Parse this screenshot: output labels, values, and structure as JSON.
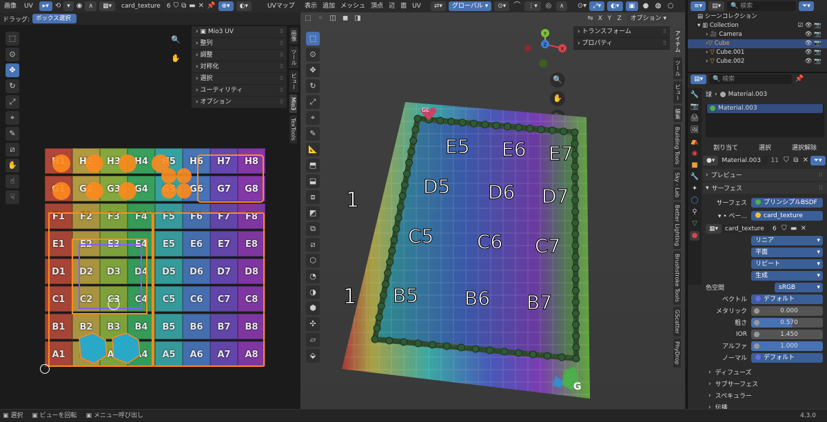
{
  "uv_editor": {
    "header": {
      "menu": [
        "画像",
        "UV"
      ],
      "image_name": "card_texture",
      "user_count": "6",
      "uv_map_label": "UVマップ",
      "drag_label": "ドラッグ:",
      "drag_mode": "ボックス選択"
    },
    "npanel": [
      "Mio3 UV",
      "整列",
      "調整",
      "対称化",
      "選択",
      "ユーティリティ",
      "オプション"
    ],
    "side_tabs": [
      "画像",
      "ツール",
      "ビュー",
      "Mio3",
      "TexTools"
    ],
    "grid_rows": [
      {
        "r": "H",
        "cells": [
          "H1",
          "H2",
          "H3",
          "H4",
          "H5",
          "H6",
          "H7",
          "H8"
        ]
      },
      {
        "r": "G",
        "cells": [
          "G1",
          "G2",
          "G3",
          "G4",
          "G5",
          "G6",
          "G7",
          "G8"
        ]
      },
      {
        "r": "F",
        "cells": [
          "F1",
          "F2",
          "F3",
          "F4",
          "F5",
          "F6",
          "F7",
          "F8"
        ]
      },
      {
        "r": "E",
        "cells": [
          "E1",
          "E2",
          "E3",
          "E4",
          "E5",
          "E6",
          "E7",
          "E8"
        ]
      },
      {
        "r": "D",
        "cells": [
          "D1",
          "D2",
          "D3",
          "D4",
          "D5",
          "D6",
          "D7",
          "D8"
        ]
      },
      {
        "r": "C",
        "cells": [
          "C1",
          "C2",
          "C3",
          "C4",
          "C5",
          "C6",
          "C7",
          "C8"
        ]
      },
      {
        "r": "B",
        "cells": [
          "B1",
          "B2",
          "B3",
          "B4",
          "B5",
          "B6",
          "B7",
          "B8"
        ]
      },
      {
        "r": "A",
        "cells": [
          "A1",
          "A2",
          "A3",
          "A4",
          "A5",
          "A6",
          "A7",
          "A8"
        ]
      }
    ]
  },
  "viewport": {
    "header": {
      "menu": [
        "表示",
        "追加",
        "メッシュ",
        "頂点",
        "辺",
        "面",
        "UV"
      ],
      "transform_orientation": "グローバル",
      "options_label": "オプション",
      "axes": [
        "X",
        "Y",
        "Z"
      ]
    },
    "npanel": [
      "トランスフォーム",
      "プロパティ"
    ],
    "gizmo_axes": [
      "Y",
      "Z",
      "X"
    ],
    "side_tabs": [
      "アイテム",
      "ツール",
      "ビュー",
      "編集",
      "Building Tools",
      "Sky - Lab",
      "Better Lighting",
      "Brushstroke Tools",
      "GScatter",
      "PhyDrop"
    ],
    "card_labels": [
      {
        "t": "E5"
      },
      {
        "t": "E6"
      },
      {
        "t": "E7"
      },
      {
        "t": "D5"
      },
      {
        "t": "D6"
      },
      {
        "t": "D7"
      },
      {
        "t": "C5"
      },
      {
        "t": "C6"
      },
      {
        "t": "C7"
      },
      {
        "t": "B5"
      },
      {
        "t": "B6"
      },
      {
        "t": "B7"
      }
    ],
    "corner_labels": {
      "top_left": "GL",
      "bottom_right": "G"
    }
  },
  "outliner": {
    "search_placeholder": "検索",
    "items": [
      {
        "label": "シーンコレクション",
        "type": "scene"
      },
      {
        "label": "Collection",
        "type": "collection"
      },
      {
        "label": "Camera",
        "type": "camera"
      },
      {
        "label": "Cube",
        "type": "mesh",
        "active": true
      },
      {
        "label": "Cube.001",
        "type": "mesh"
      },
      {
        "label": "Cube.002",
        "type": "mesh"
      }
    ]
  },
  "properties": {
    "search_placeholder": "検索",
    "breadcrumb": [
      "球",
      "Material.003"
    ],
    "slots": [
      "Material.003"
    ],
    "slot_buttons": [
      "割り当て",
      "選択",
      "選択解除"
    ],
    "material_name": "Material.003",
    "material_users": "11",
    "sections": {
      "preview": "プレビュー",
      "surface": "サーフェス"
    },
    "surface": {
      "surface_label": "サーフェス",
      "surface_value": "プリンシプルBSDF",
      "base_label": "ベー...",
      "base_value": "card_texture",
      "image_name": "card_texture",
      "image_users": "6",
      "interpolation": "リニア",
      "projection": "平面",
      "extension": "リピート",
      "source": "生成",
      "colorspace_label": "色空間",
      "colorspace_value": "sRGB",
      "vector_label": "ベクトル",
      "vector_value": "デフォルト",
      "metallic_label": "メタリック",
      "metallic_value": "0.000",
      "roughness_label": "粗さ",
      "roughness_value": "0.570",
      "ior_label": "IOR",
      "ior_value": "1.450",
      "alpha_label": "アルファ",
      "alpha_value": "1.000",
      "normal_label": "ノーマル",
      "normal_value": "デフォルト"
    },
    "subpanels": [
      "ディフューズ",
      "サブサーフェス",
      "スペキュラー",
      "伝播"
    ]
  },
  "status": {
    "select": "選択",
    "rotate": "ビューを回転",
    "menu": "メニュー呼び出し",
    "version": "4.3.0"
  }
}
